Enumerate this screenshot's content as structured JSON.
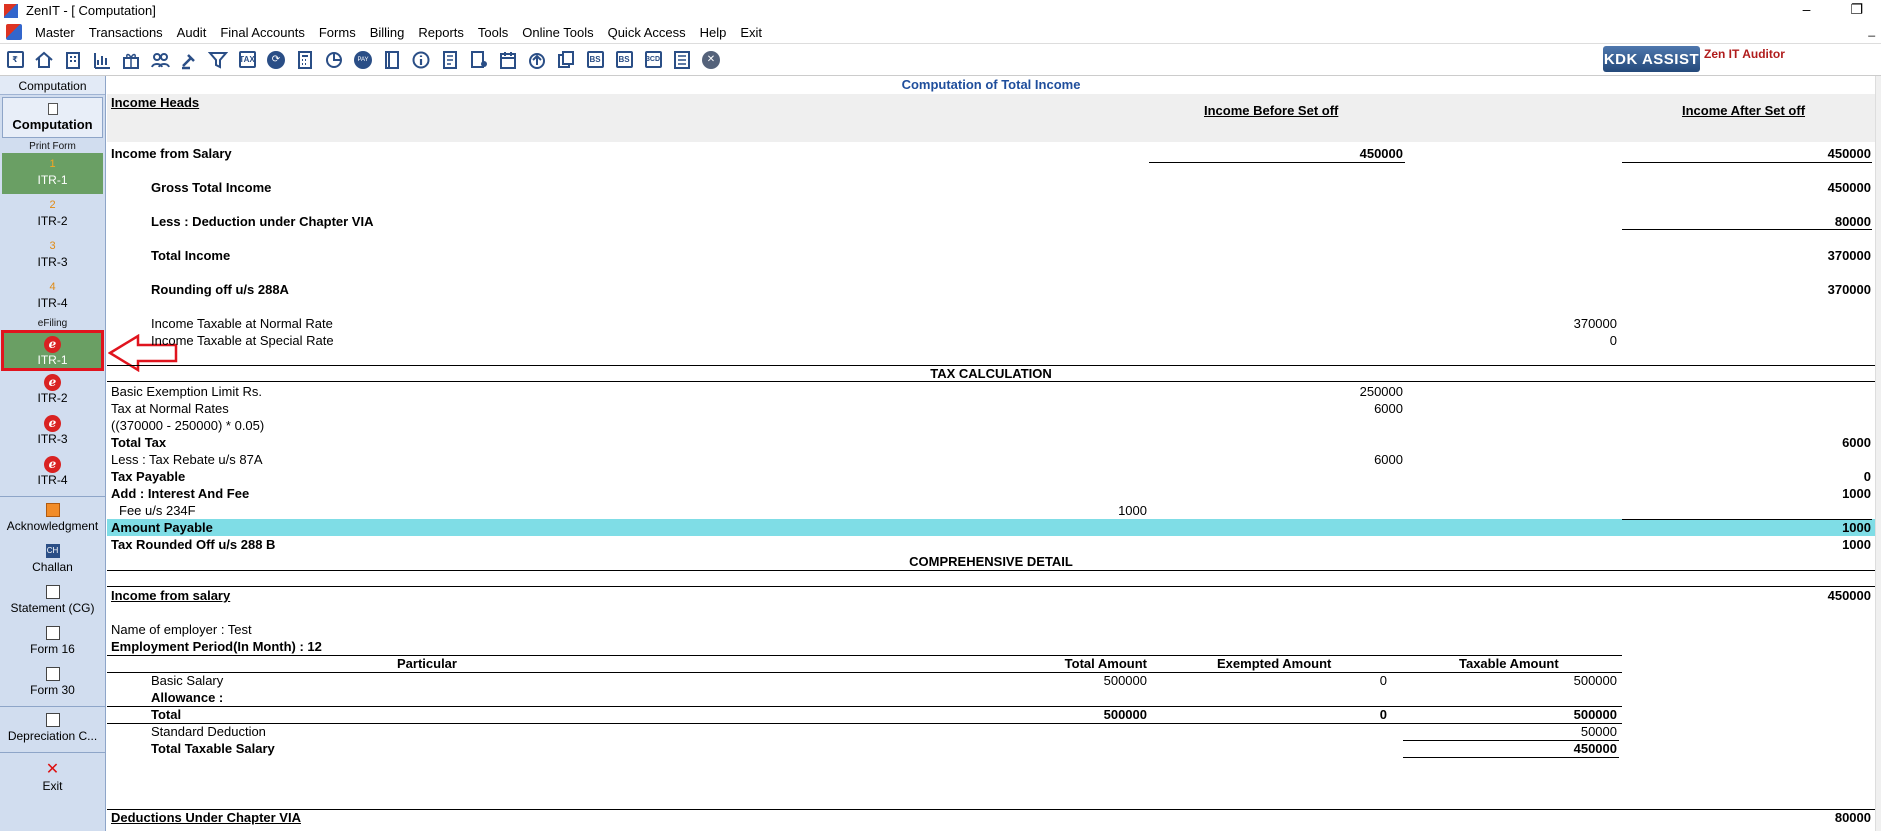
{
  "window": {
    "title": "ZenIT - [ Computation]"
  },
  "menu": [
    "Master",
    "Transactions",
    "Audit",
    "Final Accounts",
    "Forms",
    "Billing",
    "Reports",
    "Tools",
    "Online Tools",
    "Quick Access",
    "Help",
    "Exit"
  ],
  "toolbar": {
    "icons": [
      "rupee-icon",
      "home-icon",
      "building-icon",
      "bar-chart-icon",
      "gift-icon",
      "users-icon",
      "gavel-icon",
      "filter-icon",
      "tax-icon",
      "refresh-icon",
      "calculator-icon",
      "pie-chart-icon",
      "pay-icon",
      "book-icon",
      "info-icon",
      "form-icon",
      "user-form-icon",
      "calendar-icon",
      "upload-icon",
      "copy-icon",
      "bs-icon",
      "bs-sch-icon",
      "3cd-icon",
      "register-icon",
      "close-icon"
    ],
    "labels": {
      "tax": "TAX",
      "pay": "PAY",
      "bs": "BS",
      "bs2": "BS",
      "cd3": "3CD"
    },
    "kdk_label": "KDK ASSIST",
    "auditor_label": "Zen IT Auditor"
  },
  "left_panel": {
    "header": "Computation",
    "computation_label": "Computation",
    "print_form_label": "Print Form",
    "print_items": [
      {
        "num": "1",
        "label": "ITR-1"
      },
      {
        "num": "2",
        "label": "ITR-2"
      },
      {
        "num": "3",
        "label": "ITR-3"
      },
      {
        "num": "4",
        "label": "ITR-4"
      }
    ],
    "efiling_label": "eFiling",
    "efiling_items": [
      "ITR-1",
      "ITR-2",
      "ITR-3",
      "ITR-4"
    ],
    "tools": [
      "Acknowledgment",
      "Challan",
      "Statement (CG)",
      "Form 16",
      "Form 30",
      "Depreciation C...",
      "Exit"
    ],
    "challan_icon_text": "CH",
    "e_glyph": "e"
  },
  "computation": {
    "title": "Computation of Total Income",
    "income_heads": "Income Heads",
    "col_before": "Income Before Set off",
    "col_after": "Income After Set off",
    "salary_label": "Income from Salary",
    "salary_before": "450000",
    "salary_after": "450000",
    "gti_label": "Gross Total Income",
    "gti_value": "450000",
    "deduction_label": "Less : Deduction under Chapter VIA",
    "deduction_value": "80000",
    "total_income_label": "Total Income",
    "total_income_value": "370000",
    "rounding_label": "Rounding off u/s 288A",
    "rounding_value": "370000",
    "normal_rate_label": "Income Taxable at Normal Rate",
    "normal_rate_value": "370000",
    "special_rate_label": "Income Taxable at Special Rate",
    "special_rate_value": "0"
  },
  "tax_calc": {
    "title": "TAX CALCULATION",
    "exemption_label": "Basic Exemption Limit Rs.",
    "exemption_value": "250000",
    "normal_tax_label": "Tax at Normal Rates",
    "normal_tax_value": "6000",
    "formula": "((370000 - 250000) * 0.05)",
    "total_tax_label": "Total Tax",
    "total_tax_value": "6000",
    "rebate_label": "Less : Tax Rebate u/s 87A",
    "rebate_value": "6000",
    "tax_payable_label": "Tax Payable",
    "tax_payable_value": "0",
    "interest_label": "Add : Interest And Fee",
    "interest_value": "1000",
    "fee_label": "Fee u/s 234F",
    "fee_value": "1000",
    "amount_payable_label": "Amount Payable",
    "amount_payable_value": "1000",
    "rounded_label": "Tax Rounded Off u/s 288 B",
    "rounded_value": "1000"
  },
  "detail": {
    "title": "COMPREHENSIVE DETAIL",
    "salary_heading": "Income from salary",
    "salary_total": "450000",
    "employer": "Name of employer : Test",
    "period": "Employment Period(In Month) : 12",
    "columns": [
      "Particular",
      "Total Amount",
      "Exempted Amount",
      "Taxable Amount"
    ],
    "basic_label": "Basic Salary",
    "basic_total": "500000",
    "basic_exempt": "0",
    "basic_taxable": "500000",
    "allowance_label": "Allowance :",
    "total_label": "Total",
    "total_total": "500000",
    "total_exempt": "0",
    "total_taxable": "500000",
    "std_ded_label": "Standard Deduction",
    "std_ded_value": "50000",
    "taxable_salary_label": "Total Taxable Salary",
    "taxable_salary_value": "450000",
    "via_heading": "Deductions Under Chapter VIA",
    "via_value": "80000"
  }
}
